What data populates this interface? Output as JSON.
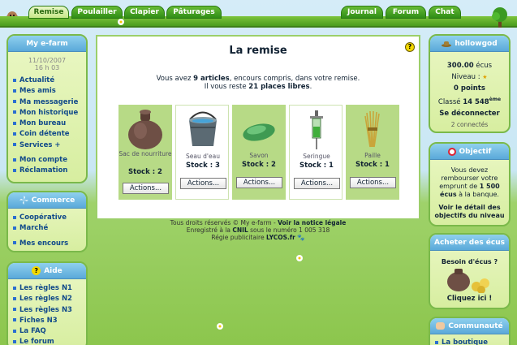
{
  "topnav": {
    "left_tabs": [
      "Remise",
      "Poulailler",
      "Clapier",
      "Pâturages"
    ],
    "right_tabs": [
      "Journal",
      "Forum",
      "Chat"
    ],
    "active": "Remise"
  },
  "myfarm": {
    "title": "My e-farm",
    "date": "11/10/2007",
    "time": "16 h 03",
    "items": [
      "Actualité",
      "Mes amis",
      "Ma messagerie",
      "Mon historique",
      "Mon bureau",
      "Coin détente",
      "Services +",
      "Mon compte",
      "Réclamation"
    ]
  },
  "commerce": {
    "title": "Commerce",
    "items": [
      "Coopérative",
      "Marché",
      "Mes encours"
    ]
  },
  "aide": {
    "title": "Aide",
    "items": [
      "Les règles N1",
      "Les règles N2",
      "Les règles N3",
      "Fiches N3",
      "La FAQ",
      "Le forum"
    ]
  },
  "main": {
    "title": "La remise",
    "help": "?",
    "intro_line1_pre": "Vous avez ",
    "intro_line1_bold": "9 articles",
    "intro_line1_post": ", encours compris, dans votre remise.",
    "intro_line2_pre": "Il vous reste ",
    "intro_line2_bold": "21 places libres",
    "intro_line2_post": ".",
    "items": [
      {
        "name": "Sac de nourriture",
        "stock": "Stock : 2",
        "action": "Actions...",
        "icon": "sack-icon"
      },
      {
        "name": "Seau d'eau",
        "stock": "Stock : 3",
        "action": "Actions...",
        "icon": "bucket-icon"
      },
      {
        "name": "Savon",
        "stock": "Stock : 2",
        "action": "Actions...",
        "icon": "soap-icon"
      },
      {
        "name": "Seringue",
        "stock": "Stock : 1",
        "action": "Actions...",
        "icon": "syringe-icon"
      },
      {
        "name": "Paille",
        "stock": "Stock : 1",
        "action": "Actions...",
        "icon": "straw-icon"
      }
    ]
  },
  "footer": {
    "line1_pre": "Tous droits réservés © My e-farm - ",
    "line1_link": "Voir la notice légale",
    "line2_pre": "Enregistré à la ",
    "line2_bold": "CNIL",
    "line2_post": " sous le numéro 1 005 318",
    "line3_pre": "Régie publicitaire ",
    "line3_bold": "LYCOS.fr"
  },
  "user": {
    "name": "hollowgod",
    "ecus": "300.00",
    "ecus_unit": " écus",
    "niveau": "Niveau :",
    "points": "0 points",
    "classe_pre": "Classé ",
    "classe_rank": "14 548",
    "classe_sup": "ème",
    "logout": "Se déconnecter",
    "connected": "2 connectés"
  },
  "objectif": {
    "title": "Objectif",
    "text_pre": "Vous devez rembourser votre emprunt de ",
    "text_bold": "1 500 écus",
    "text_post": " à la banque.",
    "link": "Voir le détail des objectifs du niveau"
  },
  "acheter": {
    "title": "Acheter des écus",
    "q": "Besoin d'écus ?",
    "cta": "Cliquez ici !"
  },
  "communaute": {
    "title": "Communauté",
    "item": "La boutique"
  }
}
